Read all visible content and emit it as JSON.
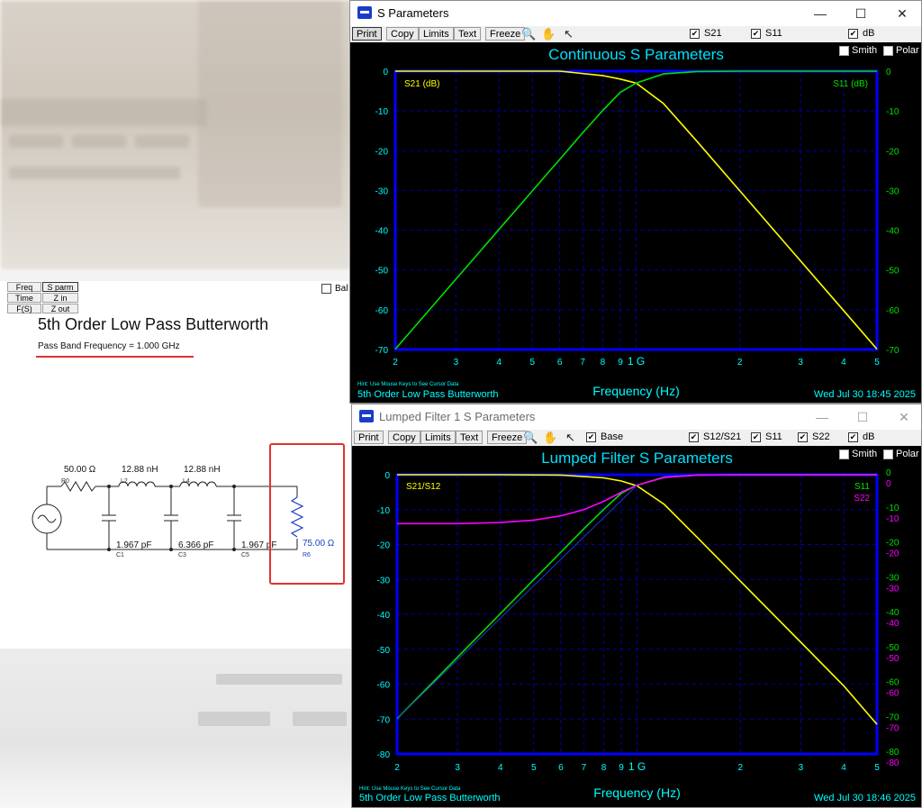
{
  "main": {
    "buttons": [
      "Freq",
      "S parm",
      "Time",
      "Z in",
      "F(S)",
      "Z out"
    ],
    "balance_label": "Bal",
    "title": "5th Order Low Pass Butterworth",
    "subtitle": "Pass Band Frequency = 1.000 GHz",
    "circuit": {
      "r0_value": "50.00 Ω",
      "r0_name": "R0",
      "l2_value": "12.88 nH",
      "l2_name": "L2",
      "l4_value": "12.88 nH",
      "l4_name": "L4",
      "c1_value": "1.967 pF",
      "c1_name": "C1",
      "c3_value": "6.366 pF",
      "c3_name": "C3",
      "c5_value": "1.967 pF",
      "c5_name": "C5",
      "r6_value": "75.00 Ω",
      "r6_name": "R6"
    }
  },
  "win1": {
    "title": "S Parameters",
    "toolbar": {
      "print": "Print",
      "copy": "Copy",
      "limits": "Limits",
      "text": "Text",
      "freeze": "Freeze",
      "checks": [
        {
          "label": "S21",
          "checked": true
        },
        {
          "label": "S11",
          "checked": true
        },
        {
          "label": "dB",
          "checked": true
        }
      ]
    },
    "smith_label": "Smith",
    "polar_label": "Polar",
    "plot_title": "Continuous S Parameters",
    "left_series_label": "S21 (dB)",
    "right_series_label": "S11 (dB)",
    "hint": "Hint: Use Mouse Keys to See Cursor Data",
    "footer_title": "5th Order Low Pass Butterworth",
    "timestamp": "Wed Jul 30 18:45 2025",
    "xlabel": "Frequency (Hz)",
    "x_tick_labels": [
      "2",
      "3",
      "4",
      "5",
      "6",
      "7",
      "8",
      "9",
      "1 G",
      "2",
      "3",
      "4",
      "5"
    ],
    "y_tick_labels": [
      "0",
      "-10",
      "-20",
      "-30",
      "-40",
      "-50",
      "-60",
      "-70"
    ]
  },
  "win2": {
    "title": "Lumped Filter 1 S Parameters",
    "toolbar": {
      "print": "Print",
      "copy": "Copy",
      "limits": "Limits",
      "text": "Text",
      "freeze": "Freeze",
      "checks": [
        {
          "label": "Base",
          "checked": true
        },
        {
          "label": "S12/S21",
          "checked": true
        },
        {
          "label": "S11",
          "checked": true
        },
        {
          "label": "S22",
          "checked": true
        },
        {
          "label": "dB",
          "checked": true
        }
      ]
    },
    "smith_label": "Smith",
    "polar_label": "Polar",
    "plot_title": "Lumped Filter S Parameters",
    "left_series_label": "S21/S12",
    "right_series_label_1": "S11",
    "right_series_label_2": "S22",
    "hint": "Hint: Use Mouse Keys to See Cursor Data",
    "footer_title": "5th Order Low Pass Butterworth",
    "timestamp": "Wed Jul 30 18:46 2025",
    "xlabel": "Frequency (Hz)",
    "x_tick_labels": [
      "2",
      "3",
      "4",
      "5",
      "6",
      "7",
      "8",
      "9",
      "1 G",
      "2",
      "3",
      "4",
      "5"
    ],
    "y_tick_labels_left": [
      "0",
      "-10",
      "-20",
      "-30",
      "-40",
      "-50",
      "-60",
      "-70",
      "-80"
    ],
    "y_tick_labels_right_s11": [
      "0",
      "-10",
      "-20",
      "-30",
      "-40",
      "-50",
      "-60",
      "-70",
      "-80"
    ],
    "y_tick_labels_right_s22": [
      "0",
      "-10",
      "-20",
      "-30",
      "-40",
      "-50",
      "-60",
      "-70",
      "-80"
    ]
  },
  "colors": {
    "s21": "#ffff00",
    "s11": "#00e000",
    "s22": "#ff00ff",
    "axis_text": "#00ffff",
    "frame": "#0000ff",
    "grid": "#0000aa",
    "title": "#00e0ff"
  },
  "chart_data": [
    {
      "type": "line",
      "title": "Continuous S Parameters",
      "xlabel": "Frequency (Hz)",
      "xscale": "log",
      "xlim": [
        200000000.0,
        5000000000.0
      ],
      "ylim": [
        -70,
        0
      ],
      "grid": true,
      "series": [
        {
          "name": "S21 (dB)",
          "x": [
            200000000.0,
            400000000.0,
            600000000.0,
            800000000.0,
            900000000.0,
            1000000000.0,
            1200000000.0,
            1500000000.0,
            2000000000.0,
            3000000000.0,
            4000000000.0,
            5000000000.0
          ],
          "y": [
            0,
            0,
            0,
            -1.1,
            -2.0,
            -3.0,
            -8.1,
            -17.6,
            -30.1,
            -47.7,
            -60.2,
            -69.9
          ]
        },
        {
          "name": "S11 (dB)",
          "x": [
            200000000.0,
            300000000.0,
            400000000.0,
            500000000.0,
            600000000.0,
            700000000.0,
            800000000.0,
            900000000.0,
            1000000000.0,
            1200000000.0,
            1500000000.0,
            2000000000.0,
            5000000000.0
          ],
          "y": [
            -69.9,
            -52.3,
            -39.8,
            -30.1,
            -22.2,
            -15.5,
            -9.9,
            -5.3,
            -3.0,
            -0.7,
            -0.1,
            0,
            0
          ]
        }
      ]
    },
    {
      "type": "line",
      "title": "Lumped Filter S Parameters",
      "xlabel": "Frequency (Hz)",
      "xscale": "log",
      "xlim": [
        200000000.0,
        5000000000.0
      ],
      "ylim": [
        -80,
        0
      ],
      "grid": true,
      "series": [
        {
          "name": "S21/S12",
          "x": [
            200000000.0,
            400000000.0,
            600000000.0,
            800000000.0,
            900000000.0,
            1000000000.0,
            1200000000.0,
            1500000000.0,
            2000000000.0,
            3000000000.0,
            4000000000.0,
            5000000000.0
          ],
          "y": [
            0,
            0,
            -0.1,
            -0.9,
            -1.8,
            -3.2,
            -8.5,
            -18.0,
            -30.5,
            -48.0,
            -60.5,
            -71.5
          ]
        },
        {
          "name": "S11",
          "x": [
            200000000.0,
            300000000.0,
            400000000.0,
            500000000.0,
            600000000.0,
            700000000.0,
            800000000.0,
            900000000.0,
            1000000000.0,
            1200000000.0,
            1500000000.0,
            2000000000.0,
            5000000000.0
          ],
          "y": [
            -69.9,
            -52.3,
            -39.8,
            -30.1,
            -22.2,
            -15.5,
            -9.9,
            -5.3,
            -3.0,
            -0.7,
            -0.1,
            0,
            0
          ]
        },
        {
          "name": "S22",
          "x": [
            200000000.0,
            300000000.0,
            400000000.0,
            500000000.0,
            600000000.0,
            700000000.0,
            800000000.0,
            900000000.0,
            1000000000.0,
            1200000000.0,
            1500000000.0,
            2000000000.0,
            5000000000.0
          ],
          "y": [
            -14.0,
            -14.0,
            -13.7,
            -13.0,
            -11.8,
            -10.0,
            -7.6,
            -5.0,
            -3.0,
            -0.8,
            -0.1,
            0,
            0
          ]
        }
      ]
    }
  ]
}
